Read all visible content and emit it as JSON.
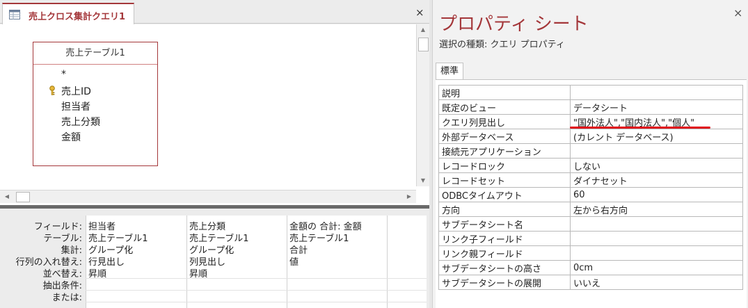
{
  "query_window": {
    "tab_label": "売上クロス集計クエリ1",
    "close_symbol": "×",
    "table": {
      "title": "売上テーブル1",
      "fields": [
        "*",
        "売上ID",
        "担当者",
        "売上分類",
        "金額"
      ]
    },
    "grid": {
      "row_labels": [
        "フィールド:",
        "テーブル:",
        "集計:",
        "行列の入れ替え:",
        "並べ替え:",
        "抽出条件:",
        "または:"
      ],
      "columns": [
        [
          "担当者",
          "売上テーブル1",
          "グループ化",
          "行見出し",
          "昇順",
          "",
          ""
        ],
        [
          "売上分類",
          "売上テーブル1",
          "グループ化",
          "列見出し",
          "昇順",
          "",
          ""
        ],
        [
          "金額の 合計: 金額",
          "売上テーブル1",
          "合計",
          "値",
          "",
          "",
          ""
        ],
        [
          "",
          "",
          "",
          "",
          "",
          "",
          ""
        ]
      ]
    }
  },
  "property_sheet": {
    "title": "プロパティ シート",
    "close_symbol": "×",
    "selection_type": "選択の種類:  クエリ プロパティ",
    "tab": "標準",
    "properties": [
      {
        "name": "説明",
        "value": ""
      },
      {
        "name": "既定のビュー",
        "value": "データシート"
      },
      {
        "name": "クエリ列見出し",
        "value": "\"国外法人\",\"国内法人\",\"個人\""
      },
      {
        "name": "外部データベース",
        "value": "(カレント データベース)"
      },
      {
        "name": "接続元アプリケーション",
        "value": ""
      },
      {
        "name": "レコードロック",
        "value": "しない"
      },
      {
        "name": "レコードセット",
        "value": "ダイナセット"
      },
      {
        "name": "ODBCタイムアウト",
        "value": "60"
      },
      {
        "name": "方向",
        "value": "左から右方向"
      },
      {
        "name": "サブデータシート名",
        "value": ""
      },
      {
        "name": "リンク子フィールド",
        "value": ""
      },
      {
        "name": "リンク親フィールド",
        "value": ""
      },
      {
        "name": "サブデータシートの高さ",
        "value": "0cm"
      },
      {
        "name": "サブデータシートの展開",
        "value": "いいえ"
      }
    ]
  },
  "colors": {
    "accent": "#a4373a",
    "highlight_underline": "#e0101a"
  }
}
